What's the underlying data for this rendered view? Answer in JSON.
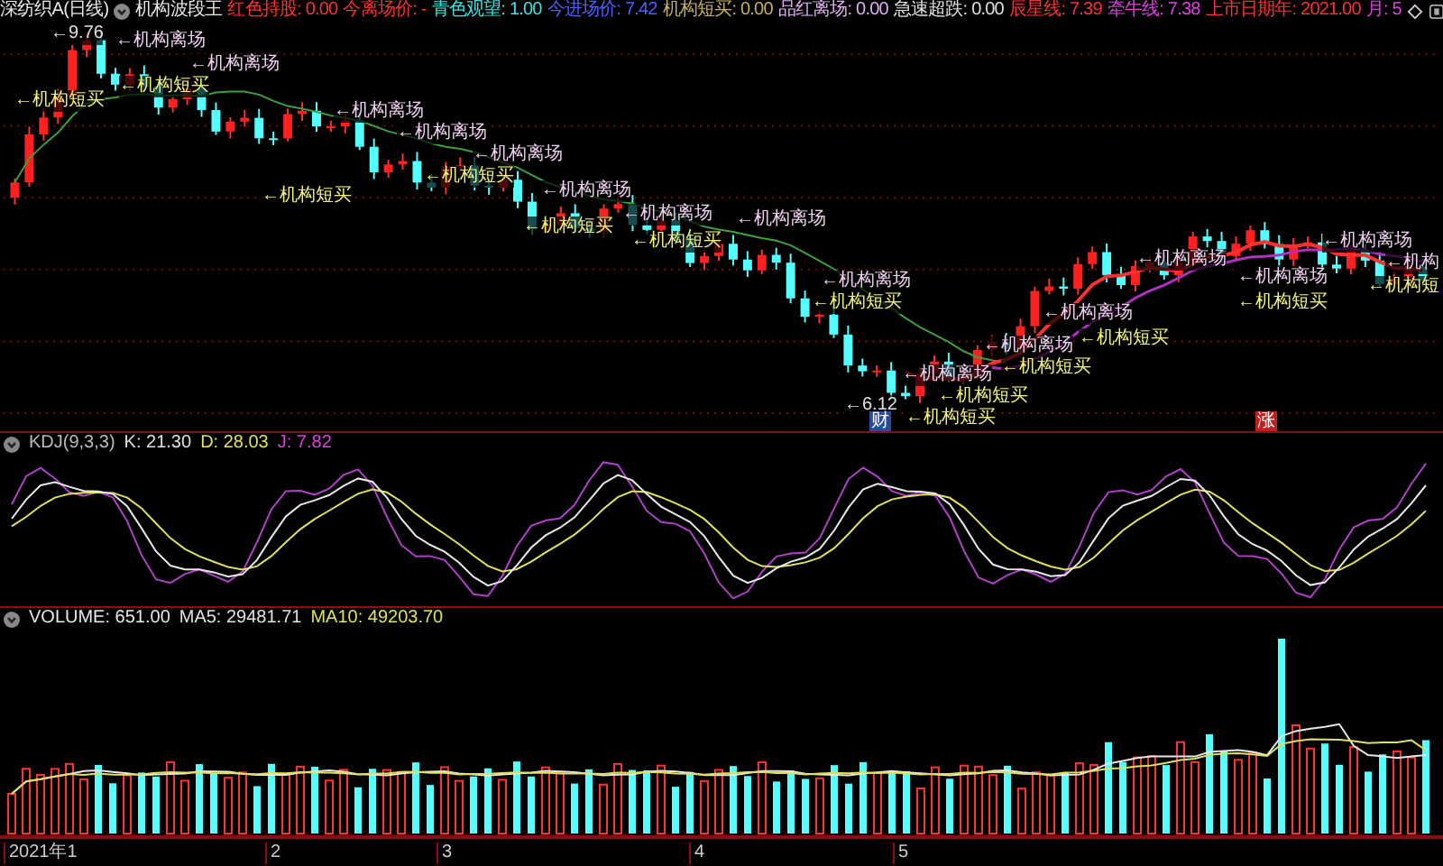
{
  "header": {
    "title": "深纺织A(日线)",
    "indicator": "机构波段王",
    "readings": [
      {
        "label": "红色持股:",
        "value": "0.00",
        "color": "#ff3030"
      },
      {
        "label": "今离场价:",
        "value": "-",
        "color": "#ff3030"
      },
      {
        "label": "青色观望:",
        "value": "1.00",
        "color": "#40e0e0"
      },
      {
        "label": "今进场价:",
        "value": "7.42",
        "color": "#4a60ff"
      },
      {
        "label": "机构短买:",
        "value": "0.00",
        "color": "#c8b060"
      },
      {
        "label": "品红离场:",
        "value": "0.00",
        "color": "#e0b0f0"
      },
      {
        "label": "急速超跌:",
        "value": "0.00",
        "color": "#e0e0e0"
      },
      {
        "label": "辰星线:",
        "value": "7.39",
        "color": "#ff3030"
      },
      {
        "label": "牵牛线:",
        "value": "7.38",
        "color": "#e040e0"
      },
      {
        "label": "上市日期年:",
        "value": "2021.00",
        "color": "#ff3030"
      },
      {
        "label": "月:",
        "value": "5",
        "color": "#e040e0"
      }
    ]
  },
  "annotations": [
    {
      "text": "←9.76",
      "kind": "price"
    },
    {
      "text": "←机构离场",
      "kind": "exit"
    },
    {
      "text": "←机构离场",
      "kind": "exit"
    },
    {
      "text": "←机构短买",
      "kind": "buy"
    },
    {
      "text": "←机构短买",
      "kind": "buy"
    },
    {
      "text": "←机构离场",
      "kind": "exit"
    },
    {
      "text": "←机构离场",
      "kind": "exit"
    },
    {
      "text": "←机构离场",
      "kind": "exit"
    },
    {
      "text": "←机构短买",
      "kind": "buy"
    },
    {
      "text": "←机构短买",
      "kind": "buy"
    },
    {
      "text": "←机构离场",
      "kind": "exit"
    },
    {
      "text": "←机构离场",
      "kind": "exit"
    },
    {
      "text": "←机构短买",
      "kind": "buy"
    },
    {
      "text": "←机构离场",
      "kind": "exit"
    },
    {
      "text": "←机构短买",
      "kind": "buy"
    },
    {
      "text": "←机构离场",
      "kind": "exit"
    },
    {
      "text": "←机构短买",
      "kind": "buy"
    },
    {
      "text": "←机构离场",
      "kind": "exit"
    },
    {
      "text": "←机构离场",
      "kind": "exit"
    },
    {
      "text": "←机构离场",
      "kind": "exit"
    },
    {
      "text": "←机构短买",
      "kind": "buy"
    },
    {
      "text": "←机构离场",
      "kind": "exit"
    },
    {
      "text": "←机构短买",
      "kind": "buy"
    },
    {
      "text": "←机构离场",
      "kind": "exit"
    },
    {
      "text": "←机构短买",
      "kind": "buy"
    },
    {
      "text": "←机构离场",
      "kind": "exit"
    },
    {
      "text": "←机构短买",
      "kind": "buy"
    },
    {
      "text": "←机构短买",
      "kind": "buy"
    },
    {
      "text": "←6.12",
      "kind": "price"
    },
    {
      "text": "←机构",
      "kind": "exit"
    },
    {
      "text": "←机构短",
      "kind": "buy"
    }
  ],
  "markers": [
    {
      "text": "财",
      "kind": "finance"
    },
    {
      "text": "涨",
      "kind": "rise"
    }
  ],
  "kdj": {
    "title": "KDJ(9,3,3)",
    "values": [
      {
        "label": "K:",
        "value": "21.30",
        "color": "#e0e0e0"
      },
      {
        "label": "D:",
        "value": "28.03",
        "color": "#e0e060"
      },
      {
        "label": "J:",
        "value": "7.82",
        "color": "#e040e0"
      }
    ]
  },
  "volume": {
    "title": "VOLUME:",
    "value": "651.00",
    "values": [
      {
        "label": "MA5:",
        "value": "29481.71",
        "color": "#e0e0e0"
      },
      {
        "label": "MA10:",
        "value": "49203.70",
        "color": "#e0e060"
      }
    ]
  },
  "axis": {
    "labels": [
      "2021年1",
      "2",
      "3",
      "4",
      "5"
    ]
  }
}
